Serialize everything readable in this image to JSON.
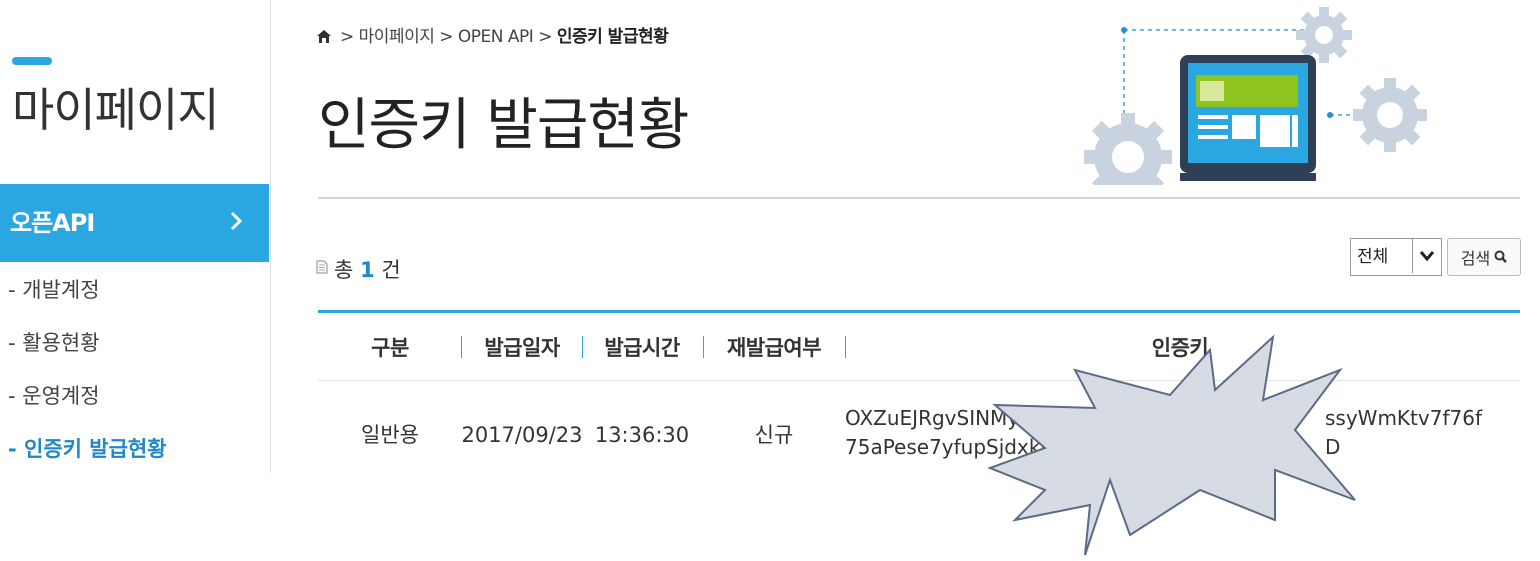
{
  "sidebar": {
    "title": "마이페이지",
    "active_section": "오픈API",
    "chevron": "›",
    "items": [
      {
        "label": "- 개발계정"
      },
      {
        "label": "- 활용현황"
      },
      {
        "label": "- 운영계정"
      },
      {
        "label": "- 인증키 발급현황"
      }
    ]
  },
  "breadcrumb": {
    "home_icon": "home-icon",
    "trail": "> 마이페이지 > OPEN API > ",
    "current": "인증키 발급현황"
  },
  "page": {
    "title": "인증키 발급현황"
  },
  "summary": {
    "prefix": "총",
    "count": "1",
    "suffix": "건"
  },
  "filter": {
    "selected": "전체",
    "search_label": "검색"
  },
  "table": {
    "headers": [
      "구분",
      "발급일자",
      "발급시간",
      "재발급여부",
      "인증키"
    ],
    "rows": [
      {
        "type": "일반용",
        "date": "2017/09/23",
        "time": "13:36:30",
        "reissue": "신규",
        "key_line1": "OXZuEJRgvSINMylb%2F",
        "key_line1_tail": "ssyWmKtv7f76f",
        "key_line2": "75aPese7yfupSjdxkri",
        "key_line2_tail": "D"
      }
    ]
  },
  "colors": {
    "accent": "#2aa7e0",
    "active_link": "#1e88c9",
    "starburst_fill": "#d6dbe4",
    "starburst_stroke": "#5b6b86"
  }
}
